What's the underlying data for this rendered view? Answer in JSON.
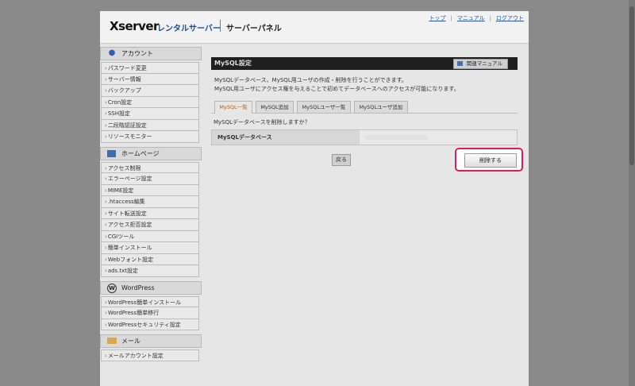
{
  "header": {
    "logo_brand": "Xserver",
    "logo_rental": "レンタルサーバー",
    "logo_panel": "サーバーパネル",
    "links": [
      "トップ",
      "マニュアル",
      "ログアウト"
    ]
  },
  "sidebar": {
    "sections": [
      {
        "title": "アカウント",
        "icon": "person-icon",
        "items": [
          "パスワード変更",
          "サーバー情報",
          "バックアップ",
          "Cron設定",
          "SSH設定",
          "二段階認証設定",
          "リソースモニター"
        ]
      },
      {
        "title": "ホームページ",
        "icon": "window-icon",
        "items": [
          "アクセス制限",
          "エラーページ設定",
          "MIME設定",
          ".htaccess編集",
          "サイト転送設定",
          "アクセス拒否設定",
          "CGIツール",
          "簡単インストール",
          "Webフォント設定",
          "ads.txt設定"
        ]
      },
      {
        "title": "WordPress",
        "icon": "wordpress-icon",
        "items": [
          "WordPress簡単インストール",
          "WordPress簡単移行",
          "WordPressセキュリティ設定"
        ]
      },
      {
        "title": "メール",
        "icon": "mail-icon",
        "items": [
          "メールアカウント設定"
        ]
      }
    ]
  },
  "main": {
    "title": "MySQL設定",
    "manual_button": "関連マニュアル",
    "description_lines": [
      "MySQLデータベース、MySQL用ユーザの作成・削除を行うことができます。",
      "MySQL用ユーザにアクセス権を与えることで初めてデータベースへのアクセスが可能になります。"
    ],
    "tabs": [
      "MySQL一覧",
      "MySQL追加",
      "MySQLユーザ一覧",
      "MySQLユーザ追加"
    ],
    "active_tab": "MySQL一覧",
    "question": "MySQLデータベースを削除しますか？",
    "table_header": "MySQLデータベース",
    "back_button": "戻る",
    "delete_button": "削除する"
  },
  "colors": {
    "highlight": "#e3195f",
    "active_tab_text": "#c05a10",
    "link": "#2255aa"
  }
}
